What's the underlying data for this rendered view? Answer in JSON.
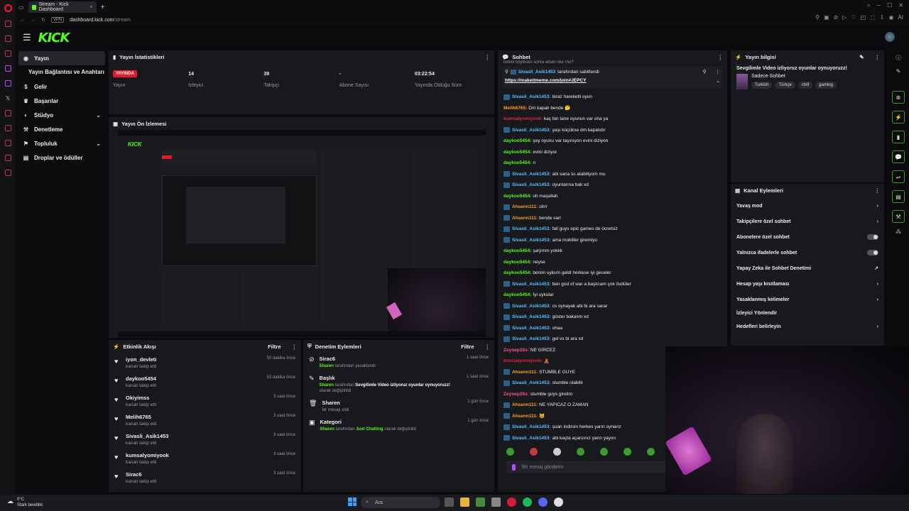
{
  "browser": {
    "tab_title": "Stream - Kick Dashboard",
    "url_vpn": "VPN",
    "url_domain": "dashboard.kick.com",
    "url_path": "/stream",
    "ai_label": "AI"
  },
  "header": {
    "logo": "KICK"
  },
  "sidebar": {
    "items": [
      {
        "label": "Yayın",
        "icon": "broadcast-icon",
        "active": true
      },
      {
        "label": "Yayın Bağlantısı ve Anahtarı",
        "sub": true
      },
      {
        "label": "Gelir",
        "icon": "dollar-icon"
      },
      {
        "label": "Başarılar",
        "icon": "trophy-icon"
      },
      {
        "label": "Stüdyo",
        "icon": "studio-icon",
        "chevron": true
      },
      {
        "label": "Denetleme",
        "icon": "hammer-icon"
      },
      {
        "label": "Topluluk",
        "icon": "community-icon",
        "chevron": true
      },
      {
        "label": "Droplar ve ödüller",
        "icon": "gift-icon"
      }
    ]
  },
  "stats": {
    "title": "Yayın İstatistikleri",
    "live_badge": "YAYINDA",
    "items": [
      {
        "value": "",
        "label": "Yayın"
      },
      {
        "value": "14",
        "label": "İzleyici"
      },
      {
        "value": "39",
        "label": "Takipçi"
      },
      {
        "value": "-",
        "label": "Abone Sayısı"
      },
      {
        "value": "03:22:54",
        "label": "Yayında Olduğu Süre"
      }
    ]
  },
  "preview": {
    "title": "Yayın Ön İzlemesi"
  },
  "activity": {
    "title": "Etkinlik Akışı",
    "filter": "Filtre",
    "items": [
      {
        "name": "iyon_devleti",
        "sub": "kanalı takip etti",
        "time": "50 dakika önce"
      },
      {
        "name": "daykoo5454",
        "sub": "kanalı takip etti",
        "time": "53 dakika önce"
      },
      {
        "name": "Okiyimss",
        "sub": "kanalı takip etti",
        "time": "3 saat önce"
      },
      {
        "name": "Melih6765",
        "sub": "kanalı takip etti",
        "time": "3 saat önce"
      },
      {
        "name": "Sivasli_Asik1453",
        "sub": "kanalı takip etti",
        "time": "3 saat önce"
      },
      {
        "name": "kumsalyomiyook",
        "sub": "kanalı takip etti",
        "time": "3 saat önce"
      },
      {
        "name": "Sirac6",
        "sub": "kanalı takip etti",
        "time": "3 saat önce"
      }
    ]
  },
  "moderation": {
    "title": "Denetim Eylemleri",
    "filter": "Filtre",
    "items": [
      {
        "name": "Sirac6",
        "actor": "Sharen",
        "text": " tarafından yasaklandı",
        "extra": "",
        "extra2": "",
        "time": "1 saat önce"
      },
      {
        "name": "Başlık",
        "actor": "Sharen",
        "text": " tarafından ",
        "extra": "Sevgilimle Video izliyoruz oyunlar oynuyoruzz!",
        "extra2": " olarak değiştirildi",
        "time": "1 saat önce"
      },
      {
        "name": "Sharen",
        "actor": "",
        "text": "bir mesajı sildi",
        "extra": "",
        "extra2": "",
        "time": "1 gün önce"
      },
      {
        "name": "Kategori",
        "actor": "Sharen",
        "text": " tarafından ",
        "extra": "Just Chatting",
        "extra2": " olarak değiştirildi",
        "time": "1 gün önce"
      }
    ]
  },
  "chat": {
    "title": "Sohbet",
    "pinned_by": "Sivasli_Asik1453",
    "pinned_suffix": " tarafından sabitlendi",
    "pinned_link": "https://makeitmeme.com/join#JEPCY",
    "top_cut": "ismini söylesen sonra atsan olur mu?",
    "messages": [
      {
        "user": "Sivasli_Asik1453:",
        "text": "biraz hareketli oyun",
        "color": "#5bc0ff",
        "badge": true
      },
      {
        "user": "Melih6765:",
        "text": "Dm kapalı bende 🤔",
        "color": "#ff9f1c",
        "badge": false
      },
      {
        "user": "kumsalyomiyook:",
        "text": "kaç bin tane oyunun var oha ya",
        "color": "#e0224a",
        "badge": false
      },
      {
        "user": "Sivasli_Asik1453:",
        "text": "yaşı küçükse dm kapalıdır",
        "color": "#5bc0ff",
        "badge": true
      },
      {
        "user": "daykoo5454:",
        "text": "şey oyunu var taşınıyon evini diziyon",
        "color": "#53fc18",
        "badge": false
      },
      {
        "user": "daykoo5454:",
        "text": "evini diziyor",
        "color": "#53fc18",
        "badge": false
      },
      {
        "user": "daykoo5454:",
        "text": "n",
        "color": "#53fc18",
        "badge": false
      },
      {
        "user": "Sivasli_Asik1453:",
        "text": "abi sana ss atabiliyom mu",
        "color": "#5bc0ff",
        "badge": true
      },
      {
        "user": "Sivasli_Asik1453:",
        "text": "oyunlarına bak xd",
        "color": "#5bc0ff",
        "badge": true
      },
      {
        "user": "daykoo5454:",
        "text": "oh maşallah",
        "color": "#53fc18",
        "badge": false
      },
      {
        "user": "Ahsenn111:",
        "text": "olrrr",
        "color": "#ff9f1c",
        "badge": true
      },
      {
        "user": "Ahsenn111:",
        "text": "bende varr",
        "color": "#ff9f1c",
        "badge": true
      },
      {
        "user": "Sivasli_Asik1453:",
        "text": "fall guys epic games de ücretsiz",
        "color": "#5bc0ff",
        "badge": true
      },
      {
        "user": "Sivasli_Asik1453:",
        "text": "ama mobiller giremiyo",
        "color": "#5bc0ff",
        "badge": true
      },
      {
        "user": "daykoo5454:",
        "text": "şarjımm yokkk",
        "color": "#53fc18",
        "badge": false
      },
      {
        "user": "daykoo5454:",
        "text": "neyse",
        "color": "#53fc18",
        "badge": false
      },
      {
        "user": "daykoo5454:",
        "text": "benim uykum geldi herkese iyi geceler",
        "color": "#53fc18",
        "badge": false
      },
      {
        "user": "Sivasli_Asik1453:",
        "text": "ben god of war a başlıcam çok övdüler",
        "color": "#5bc0ff",
        "badge": true
      },
      {
        "user": "daykoo5454:",
        "text": "İyi uykular",
        "color": "#53fc18",
        "badge": false
      },
      {
        "user": "Sivasli_Asik1453:",
        "text": "cs oynayak abi bi ara sarar",
        "color": "#5bc0ff",
        "badge": true
      },
      {
        "user": "Sivasli_Asik1453:",
        "text": "göster bakalım xd",
        "color": "#5bc0ff",
        "badge": true
      },
      {
        "user": "Sivasli_Asik1453:",
        "text": "ohaa",
        "color": "#5bc0ff",
        "badge": true
      },
      {
        "user": "Sivasli_Asik1453:",
        "text": "gel vs bi ara xd",
        "color": "#5bc0ff",
        "badge": true
      },
      {
        "user": "Zeynep28x:",
        "text": "NE GİRCEZ",
        "color": "#ff4d8d",
        "badge": false
      },
      {
        "user": "kumsalyomiyook:",
        "text": "🧸",
        "color": "#e0224a",
        "badge": false
      },
      {
        "user": "Ahsenn111:",
        "text": "STUMBLE GUYE",
        "color": "#ff9f1c",
        "badge": true
      },
      {
        "user": "Sivasli_Asik1453:",
        "text": "stumble olabilir",
        "color": "#5bc0ff",
        "badge": true
      },
      {
        "user": "Zeynep28x:",
        "text": "stumble guys girelim",
        "color": "#ff4d8d",
        "badge": false
      },
      {
        "user": "Ahsenn111:",
        "text": "NE YAPICAZ O ZAMAN",
        "color": "#ff9f1c",
        "badge": true
      },
      {
        "user": "Ahsenn111:",
        "text": "😺",
        "color": "#ff9f1c",
        "badge": true
      },
      {
        "user": "Sivasli_Asik1453:",
        "text": "şuan indirsin herkes yarın oynarız",
        "color": "#5bc0ff",
        "badge": true
      },
      {
        "user": "Sivasli_Asik1453:",
        "text": "abi kaçta açarsınız yarın yayını",
        "color": "#5bc0ff",
        "badge": true
      }
    ],
    "input_placeholder": "Bir mesaj gönderin"
  },
  "stream_info": {
    "title": "Yayın bilgisi",
    "stream_title": "Sevgilimle Video izliyoruz oyunlar oynuyoruzz!",
    "category": "Sadece Sohbet",
    "tags": [
      "Turkish",
      "Türkçe",
      "chill",
      "gaming"
    ]
  },
  "channel_actions": {
    "title": "Kanal Eylemleri",
    "items": [
      {
        "label": "Yavaş mod",
        "control": "chevron"
      },
      {
        "label": "Takipçilere özel sohbet",
        "control": "chevron"
      },
      {
        "label": "Abonelere özel sohbet",
        "control": "toggle"
      },
      {
        "label": "Yalnızca ifadelerle sohbet",
        "control": "toggle"
      },
      {
        "label": "Yapay Zeka ile Sohbet Denetimi",
        "control": "external"
      },
      {
        "label": "Hesap yaşı kısıtlaması",
        "control": "chevron"
      },
      {
        "label": "Yasaklanmış kelimeler",
        "control": "chevron"
      },
      {
        "label": "İzleyici Yönlendir",
        "control": "none"
      },
      {
        "label": "Hedefleri belirleyin",
        "control": "chevron"
      }
    ]
  },
  "taskbar": {
    "temp": "0°C",
    "weather": "Stark bewölkt",
    "search": "Ara"
  }
}
